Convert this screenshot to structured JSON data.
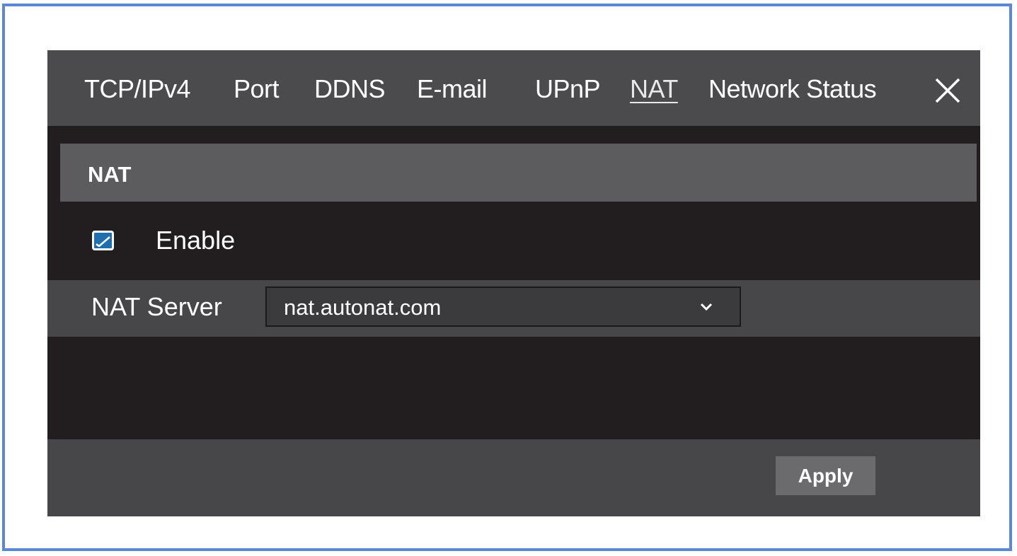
{
  "tabs": [
    {
      "label": "TCP/IPv4"
    },
    {
      "label": "Port"
    },
    {
      "label": "DDNS"
    },
    {
      "label": "E-mail"
    },
    {
      "label": "UPnP"
    },
    {
      "label": "NAT",
      "active": true
    },
    {
      "label": "Network Status"
    }
  ],
  "close_icon": "close-icon",
  "section": {
    "title": "NAT"
  },
  "enable": {
    "label": "Enable",
    "checked": true
  },
  "nat_server": {
    "label": "NAT Server",
    "value": "nat.autonat.com",
    "icon": "chevron-down-icon"
  },
  "footer": {
    "apply_label": "Apply"
  },
  "colors": {
    "frame_border": "#5b87d6",
    "tabbar_bg": "#4b4b4d",
    "panel_bg": "#221e1f",
    "section_bg": "#5c5c5e",
    "checkbox_accent": "#1e6fae"
  }
}
